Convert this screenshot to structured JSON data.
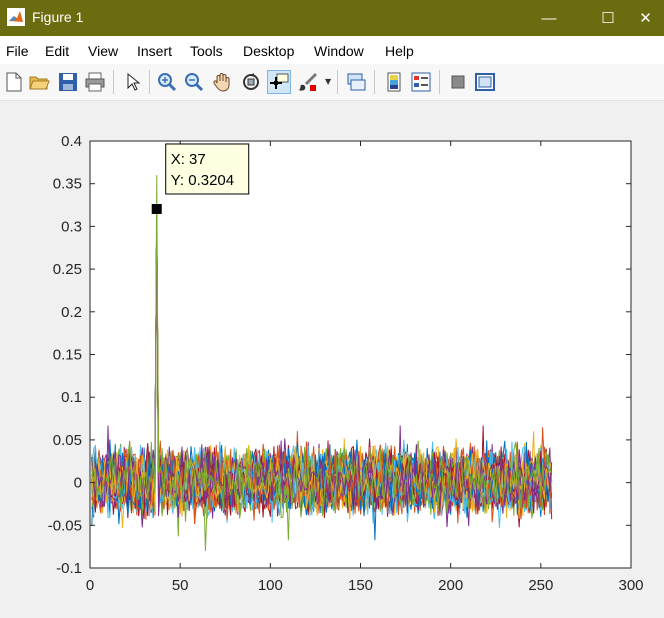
{
  "window": {
    "title": "Figure 1",
    "minimize": "—",
    "maximize": "☐",
    "close": "✕"
  },
  "menu": [
    "File",
    "Edit",
    "View",
    "Insert",
    "Tools",
    "Desktop",
    "Window",
    "Help"
  ],
  "toolbar": [
    "new-figure-icon",
    "open-file-icon",
    "save-icon",
    "print-icon",
    "pointer-icon",
    "zoom-in-icon",
    "zoom-out-icon",
    "pan-hand-icon",
    "rotate-3d-icon",
    "data-cursor-icon",
    "brush-icon",
    "link-plot-icon",
    "colorbar-icon",
    "legend-icon",
    "hide-plot-tools-icon",
    "show-plot-tools-icon"
  ],
  "chart_data": {
    "type": "line",
    "title": "",
    "xlabel": "",
    "ylabel": "",
    "xlim": [
      0,
      300
    ],
    "ylim": [
      -0.1,
      0.4
    ],
    "xticks": [
      "0",
      "50",
      "100",
      "150",
      "200",
      "250",
      "300"
    ],
    "yticks": [
      "-0.1",
      "-0.05",
      "0",
      "0.05",
      "0.1",
      "0.15",
      "0.2",
      "0.25",
      "0.3",
      "0.35",
      "0.4"
    ],
    "grid": false,
    "n_series": 40,
    "n_points": 256,
    "noise_range": [
      -0.08,
      0.09
    ],
    "peak": {
      "x": 37,
      "y": 0.3204,
      "max_y": 0.36
    },
    "series_colors": [
      "#0072bd",
      "#d95319",
      "#edb120",
      "#7e2f8e",
      "#77ac30",
      "#4dbeee",
      "#a2142f"
    ],
    "datatip": {
      "x_label": "X: 37",
      "y_label": "Y: 0.3204"
    }
  }
}
